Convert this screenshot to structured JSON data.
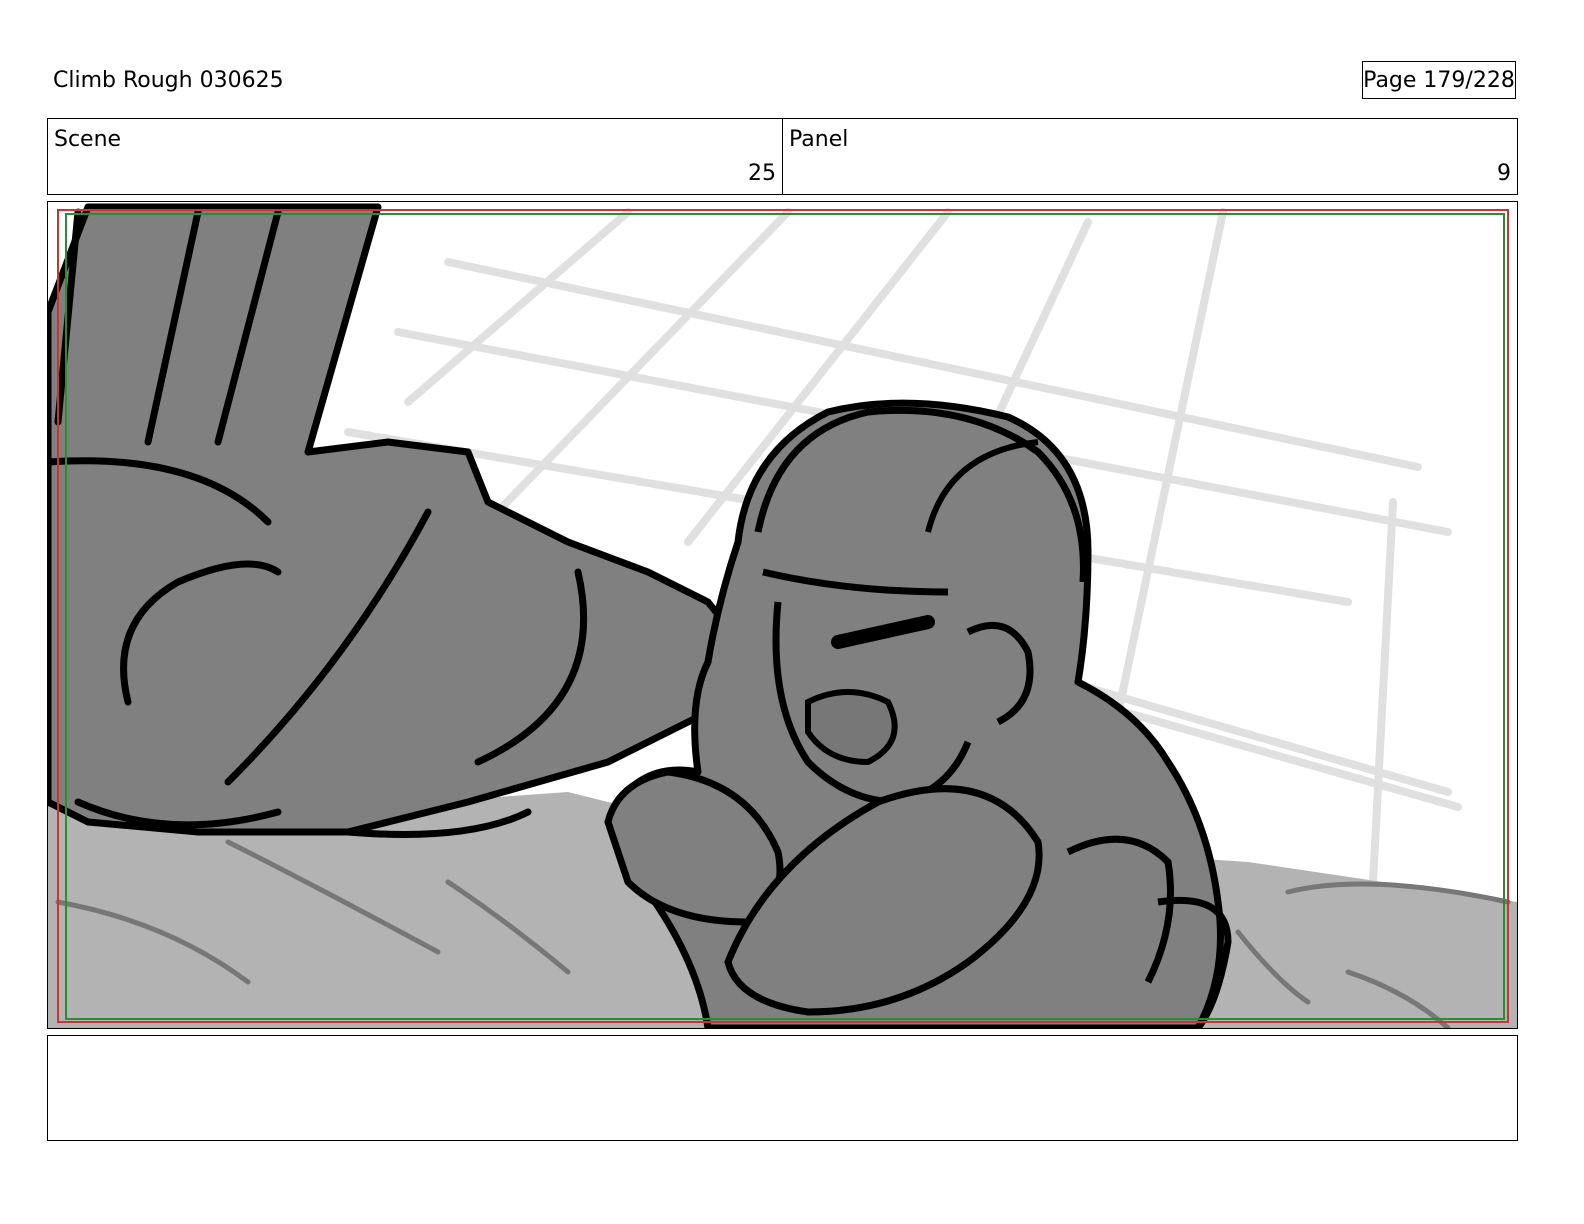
{
  "header": {
    "title": "Climb Rough 030625",
    "page": "Page 179/228"
  },
  "info": {
    "scene_label": "Scene",
    "scene_value": "25",
    "panel_label": "Panel",
    "panel_value": "9"
  },
  "notes": {
    "text": ""
  },
  "colors": {
    "ink": "#000000",
    "fill_dark": "#808080",
    "fill_light": "#b3b3b3",
    "grid_lines": "#e0e0e0",
    "safe_frame_red": "#cc3333",
    "safe_frame_green": "#2e8b2e"
  }
}
